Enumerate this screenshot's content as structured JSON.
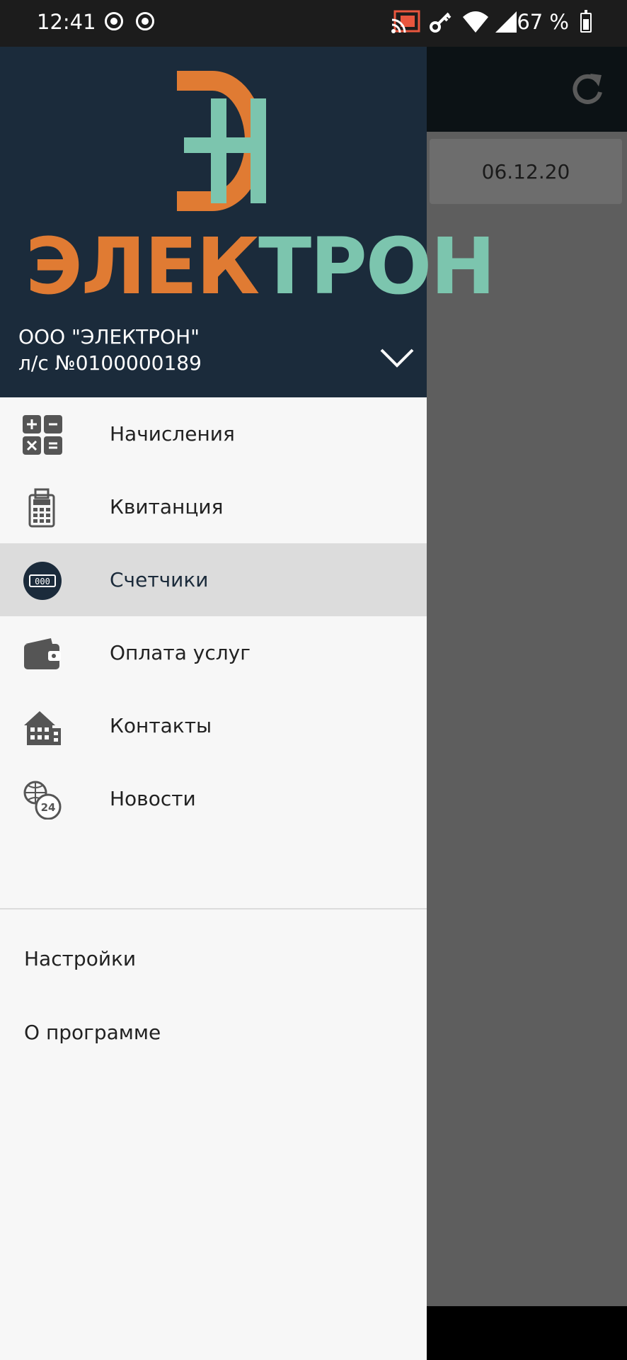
{
  "status_bar": {
    "time": "12:41",
    "battery": "67 %"
  },
  "background_app": {
    "date": "06.12.20"
  },
  "drawer": {
    "brand_left": "ЭЛЕК",
    "brand_right": "ТРОН",
    "organization": "ООО \"ЭЛЕКТРОН\"",
    "account": "л/с №0100000189",
    "menu": [
      {
        "label": "Начисления",
        "icon": "calculator-icon"
      },
      {
        "label": "Квитанция",
        "icon": "receipt-icon"
      },
      {
        "label": "Счетчики",
        "icon": "meter-icon",
        "selected": true
      },
      {
        "label": "Оплата услуг",
        "icon": "wallet-icon"
      },
      {
        "label": "Контакты",
        "icon": "building-icon"
      },
      {
        "label": "Новости",
        "icon": "globe-24-icon"
      }
    ],
    "secondary": [
      {
        "label": "Настройки"
      },
      {
        "label": "О программе"
      }
    ],
    "colors": {
      "header_bg": "#1b2b3b",
      "orange": "#e07b33",
      "teal": "#7cc5ae"
    }
  }
}
